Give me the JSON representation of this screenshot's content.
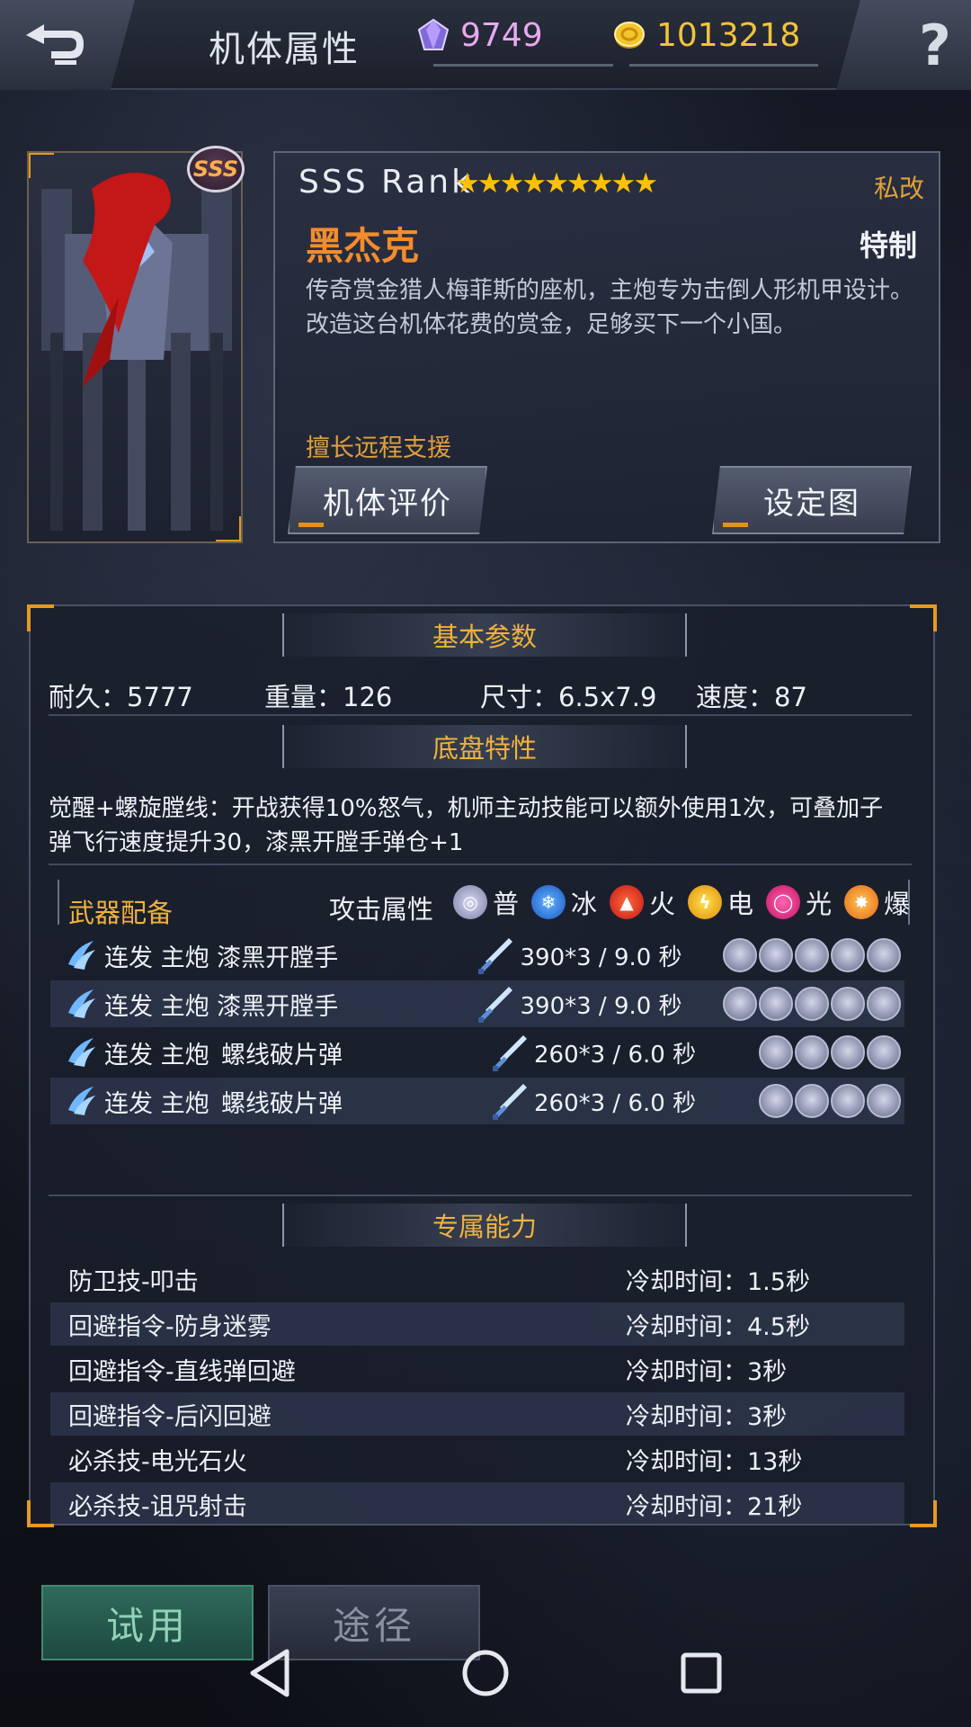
{
  "header": {
    "title": "机体属性",
    "gems": "9749",
    "gold": "1013218"
  },
  "mech": {
    "rank": "SSS Rank",
    "stars": "★★★★★★★★★",
    "badge": "SSS",
    "private_tag": "私改",
    "name": "黑杰克",
    "special_tag": "特制",
    "description": "传奇赏金猎人梅菲斯的座机，主炮专为击倒人形机甲设计。改造这台机体花费的赏金，足够买下一个小国。",
    "specialty": "擅长远程支援",
    "eval_button": "机体评价",
    "setting_button": "设定图"
  },
  "basic": {
    "heading": "基本参数",
    "durability": "耐久：5777",
    "weight": "重量：126",
    "size": "尺寸：6.5x7.9",
    "speed": "速度：87"
  },
  "chassis": {
    "heading": "底盘特性",
    "text": "觉醒+螺旋膛线：开战获得10%怒气，机师主动技能可以额外使用1次，可叠加子弹飞行速度提升30，漆黑开膛手弹仓+1"
  },
  "weapons": {
    "heading": "武器配备",
    "attr_label": "攻击属性",
    "attrs": [
      "普",
      "冰",
      "火",
      "电",
      "光",
      "爆"
    ],
    "rows": [
      {
        "type": "连发 主炮",
        "name": "漆黑开膛手",
        "damage": "390*3 / 9.0 秒",
        "slots": 5
      },
      {
        "type": "连发 主炮",
        "name": "漆黑开膛手",
        "damage": "390*3 / 9.0 秒",
        "slots": 5
      },
      {
        "type": "连发 主炮",
        "name": "螺线破片弹",
        "damage": "260*3 / 6.0 秒",
        "slots": 4
      },
      {
        "type": "连发 主炮",
        "name": "螺线破片弹",
        "damage": "260*3 / 6.0 秒",
        "slots": 4
      }
    ]
  },
  "abilities": {
    "heading": "专属能力",
    "rows": [
      {
        "name": "防卫技-叩击",
        "cooldown": "冷却时间：1.5秒"
      },
      {
        "name": "回避指令-防身迷雾",
        "cooldown": "冷却时间：4.5秒"
      },
      {
        "name": "回避指令-直线弹回避",
        "cooldown": "冷却时间：3秒"
      },
      {
        "name": "回避指令-后闪回避",
        "cooldown": "冷却时间：3秒"
      },
      {
        "name": "必杀技-电光石火",
        "cooldown": "冷却时间：13秒"
      },
      {
        "name": "必杀技-诅咒射击",
        "cooldown": "冷却时间：21秒"
      }
    ]
  },
  "footer": {
    "trial_button": "试用",
    "source_button": "途径"
  },
  "colors": {
    "accent_orange": "#e69a1e",
    "heading_gold": "#f0b23b",
    "name_orange": "#f28c2e",
    "gem_pink": "#e7a9ef",
    "gold_yellow": "#f2c33a"
  }
}
